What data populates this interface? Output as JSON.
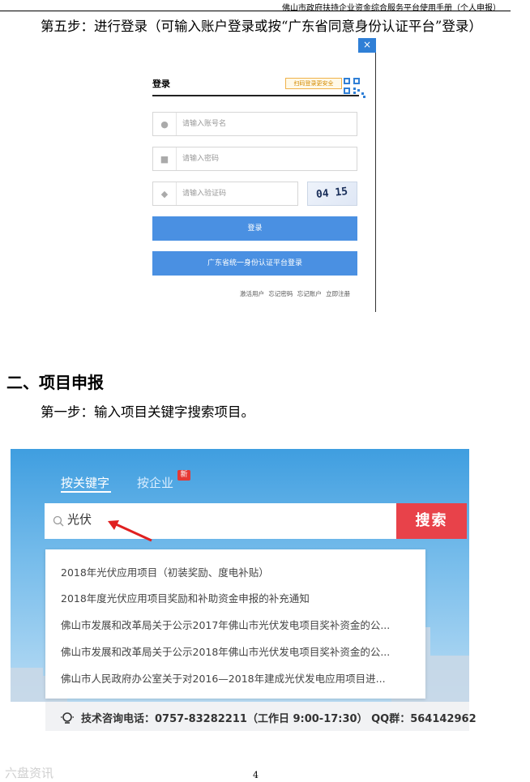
{
  "header": {
    "title": "佛山市政府扶持企业资金综合服务平台使用手册（个人申报）"
  },
  "step5": {
    "text": "第五步：进行登录（可输入账户登录或按“广东省同意身份认证平台”登录）"
  },
  "login": {
    "close": "×",
    "title": "登录",
    "qr_hint": "扫码登录更安全",
    "account_placeholder": "请输入账号名",
    "password_placeholder": "请输入密码",
    "captcha_placeholder": "请输入验证码",
    "captcha_text": "04 15",
    "login_button": "登录",
    "gd_button": "广东省统一身份认证平台登录",
    "links": [
      "激活用户",
      "忘记密码",
      "忘记账户",
      "立即注册"
    ]
  },
  "section2": {
    "title": "二、项目申报"
  },
  "step1": {
    "text": "第一步：输入项目关键字搜索项目。"
  },
  "search": {
    "tab_keyword": "按关键字",
    "tab_company": "按企业",
    "new_badge": "新",
    "query": "光伏",
    "button": "搜索",
    "suggestions": [
      "2018年光伏应用项目（初装奖励、度电补贴）",
      "2018年度光伏应用项目奖励和补助资金申报的补充通知",
      "佛山市发展和改革局关于公示2017年佛山市光伏发电项目奖补资金的公...",
      "佛山市发展和改革局关于公示2018年佛山市光伏发电项目奖补资金的公...",
      "佛山市人民政府办公室关于对2016—2018年建成光伏发电应用项目进..."
    ],
    "tech_support": "技术咨询电话：0757-83282211（工作日 9:00-17:30） QQ群：564142962"
  },
  "footer": {
    "page_number": "4",
    "watermark": "六盘资讯"
  },
  "colors": {
    "accent_blue": "#4a90e2",
    "search_red": "#e8424a",
    "sky_blue": "#3f9ee0"
  }
}
